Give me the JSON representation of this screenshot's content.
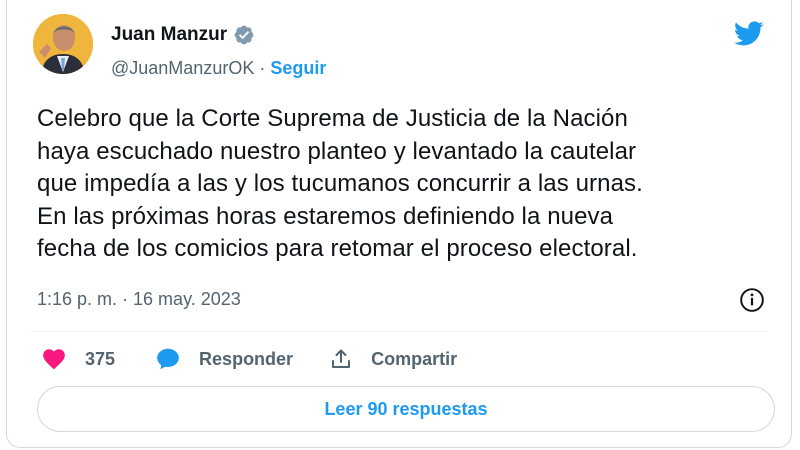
{
  "author": {
    "name": "Juan Manzur",
    "handle": "@JuanManzurOK",
    "separator": " · ",
    "follow_label": "Seguir"
  },
  "tweet": {
    "text": "Celebro que la Corte Suprema de Justicia de la Nación\nhaya escuchado nuestro planteo y levantado la cautelar\nque impedía a las y los tucumanos concurrir a las urnas.\nEn las próximas horas estaremos definiendo la nueva\nfecha de los comicios para retomar el proceso electoral.",
    "timestamp": "1:16 p. m. · 16 may. 2023"
  },
  "actions": {
    "likes": "375",
    "reply_label": "Responder",
    "share_label": "Compartir"
  },
  "read_replies_label": "Leer 90 respuestas",
  "icons": {
    "verified": "verified-badge-icon",
    "logo": "twitter-bird-icon",
    "info": "info-icon",
    "like": "heart-icon",
    "reply": "speech-bubble-icon",
    "share": "share-upload-icon"
  },
  "colors": {
    "accent": "#1d9bf0",
    "like": "#f91880",
    "text": "#0f1419",
    "muted": "#536471"
  }
}
